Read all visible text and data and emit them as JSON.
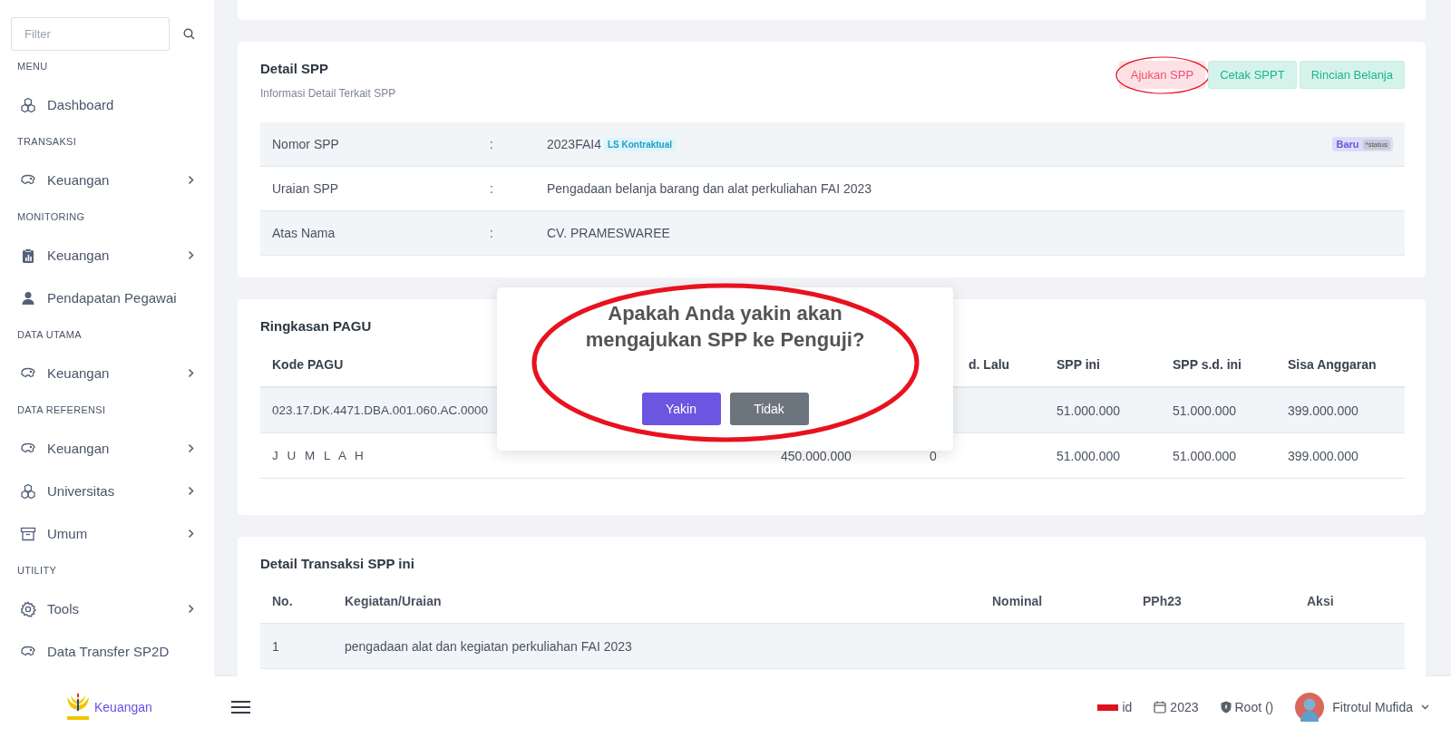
{
  "sidebar": {
    "filter": {
      "placeholder": "Filter"
    },
    "sections": [
      {
        "title": "MENU",
        "items": [
          {
            "label": "Dashboard",
            "expandable": false
          }
        ]
      },
      {
        "title": "TRANSAKSI",
        "items": [
          {
            "label": "Keuangan",
            "expandable": true
          }
        ]
      },
      {
        "title": "MONITORING",
        "items": [
          {
            "label": "Keuangan",
            "expandable": true
          },
          {
            "label": "Pendapatan Pegawai",
            "expandable": false
          }
        ]
      },
      {
        "title": "DATA UTAMA",
        "items": [
          {
            "label": "Keuangan",
            "expandable": true
          }
        ]
      },
      {
        "title": "DATA REFERENSI",
        "items": [
          {
            "label": "Keuangan",
            "expandable": true
          },
          {
            "label": "Universitas",
            "expandable": true
          },
          {
            "label": "Umum",
            "expandable": true
          }
        ]
      },
      {
        "title": "UTILITY",
        "items": [
          {
            "label": "Tools",
            "expandable": true
          },
          {
            "label": "Data Transfer SP2D",
            "expandable": false
          }
        ]
      }
    ]
  },
  "detail_spp": {
    "title": "Detail SPP",
    "subtitle": "Informasi Detail Terkait SPP",
    "buttons": [
      {
        "label": "Ajukan SPP",
        "kind": "danger",
        "highlighted": true
      },
      {
        "label": "Cetak SPPT",
        "kind": "success",
        "highlighted": false
      },
      {
        "label": "Rincian Belanja",
        "kind": "success",
        "highlighted": false
      }
    ],
    "rows": [
      {
        "label": "Nomor SPP",
        "separator": ":",
        "value": "2023FAI4",
        "tag": "LS Kontraktual",
        "status": "Baru",
        "status_note": "*status"
      },
      {
        "label": "Uraian SPP",
        "separator": ":",
        "value": "Pengadaan belanja barang dan alat perkuliahan FAI 2023"
      },
      {
        "label": "Atas Nama",
        "separator": ":",
        "value": "CV. PRAMESWAREE"
      }
    ]
  },
  "ringkasan_pagu": {
    "title": "Ringkasan PAGU",
    "columns": {
      "kode_pagu": "Kode PAGU",
      "column_4": "d. Lalu",
      "spp_ini": "SPP ini",
      "spp_sd_ini": "SPP s.d. ini",
      "sisa_anggaran": "Sisa Anggaran"
    },
    "rows": [
      {
        "kode_pagu": "023.17.DK.4471.DBA.001.060.AC.0000",
        "spp_ini": "51.000.000",
        "spp_sd_ini": "51.000.000",
        "sisa_anggaran": "399.000.000"
      },
      {
        "kode_pagu": "J U M L A H",
        "column_3": "450.000.000",
        "column_4": "0",
        "spp_ini": "51.000.000",
        "spp_sd_ini": "51.000.000",
        "sisa_anggaran": "399.000.000"
      }
    ]
  },
  "detail_transaksi": {
    "title": "Detail Transaksi SPP ini",
    "columns": {
      "no": "No.",
      "kegiatan_uraian": "Kegiatan/Uraian",
      "nominal": "Nominal",
      "pph23": "PPh23",
      "aksi": "Aksi"
    },
    "rows": [
      {
        "no": "1",
        "kegiatan_uraian": "pengadaan alat dan kegiatan perkuliahan FAI 2023"
      }
    ]
  },
  "dialog": {
    "title": "Apakah Anda yakin akan mengajukan SPP ke Penguji?",
    "highlighted": true,
    "buttons": [
      {
        "label": "Yakin",
        "kind": "primary"
      },
      {
        "label": "Tidak",
        "kind": "secondary"
      }
    ]
  },
  "bottom_bar": {
    "brand": "Keuangan",
    "language": "id",
    "year": "2023",
    "role": "Root ()",
    "user": "Fitrotul Mufida"
  }
}
